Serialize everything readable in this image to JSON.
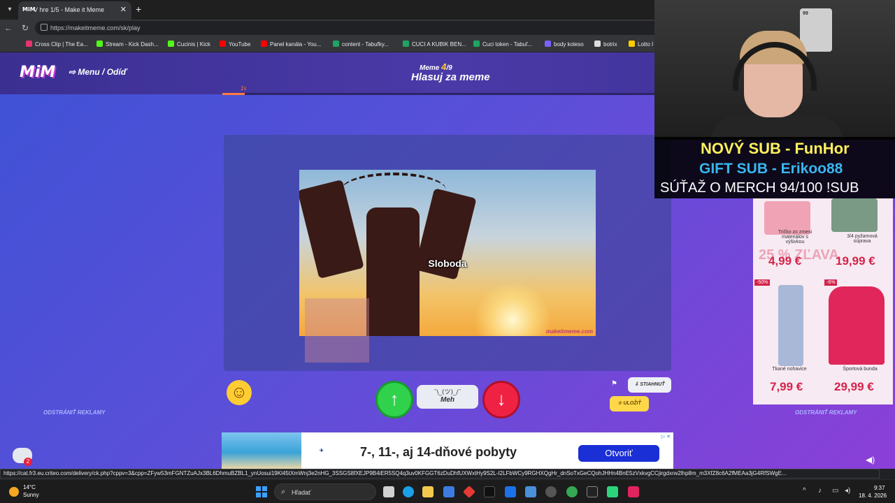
{
  "browser": {
    "tab_title": "V hre 1/5 - Make it Meme",
    "tab_favicon": "MiM",
    "url": "https://makeitmeme.com/sk/play",
    "bookmarks": [
      {
        "label": "Cross Clip | The Ea...",
        "color": "#e8336b"
      },
      {
        "label": "Stream - Kick Dash...",
        "color": "#53fc18"
      },
      {
        "label": "Cucinis | Kick",
        "color": "#53fc18"
      },
      {
        "label": "YouTube",
        "color": "#ff0000"
      },
      {
        "label": "Panel kanála - You...",
        "color": "#ff0000"
      },
      {
        "label": "content - Tabuľky...",
        "color": "#1fa463"
      },
      {
        "label": "CUCI A KUBIK BEN...",
        "color": "#1fa463"
      },
      {
        "label": "Cuci token - Tabuľ...",
        "color": "#1fa463"
      },
      {
        "label": "body koleso",
        "color": "#7b61ff"
      },
      {
        "label": "botrix",
        "color": "#dddddd"
      },
      {
        "label": "Lotto I",
        "color": "#ffcc00"
      }
    ]
  },
  "header": {
    "logo": "MiM",
    "menu_label": "Menu / Odíď",
    "round_prefix": "Meme",
    "round_current": "4",
    "round_total": "/9",
    "title": "Hlasuj za meme",
    "timer_label": "1s",
    "timer_fraction": 0.05
  },
  "meme": {
    "caption": "Sloboda",
    "watermark": "makeitmeme.com"
  },
  "vote": {
    "up_icon": "arrow-up-icon",
    "meh_face": "¯\\_(ツ)_/¯",
    "meh_label": "Meh",
    "down_icon": "arrow-down-icon",
    "download_label": "STIAHNUŤ",
    "save_label": "ULOŽIŤ",
    "remove_ads_left": "ODSTRÁNIŤ REKLAMY",
    "remove_ads_right": "ODSTRÁNIŤ REKLAMY"
  },
  "ad_banner": {
    "text": "7-, 11-, aj 14-dňové pobyty",
    "cta": "Otvoriť"
  },
  "side_ad": {
    "headline": "25 % ZĽAVA",
    "items": [
      {
        "name": "Tričko zo zmesi materiálov s výšivkou",
        "price": "4,99 €",
        "discount": ""
      },
      {
        "name": "3/4 pyžamová súprava",
        "price": "19,99 €",
        "discount": ""
      },
      {
        "name": "Tkané nohavice",
        "price": "7,99 €",
        "discount": "-50%"
      },
      {
        "name": "Športová bunda",
        "price": "29,99 €",
        "discount": "-6%"
      }
    ]
  },
  "chat": {
    "badge": "2"
  },
  "status_url": "https://cat.fr3.eu.criteo.com/delivery/ck.php?cppv=3&cpp=ZFyw53mFGNTZuAJx3BL6DhmuBZBL1_ynUosui19Kl45tXmWnj3e2nHG_3SSGS8fXEJP9B4iER5SQ4q3uv0KFGGT6zDuDhfUXWxtHy9S2L-I2LFbWCy9RGHXQgHr_dnSoTxGeCQohJHHn4BnE5zVxkvgCCjirgdxrw2lhp8m_m3XfZ8c6A2fMEAa3jG4RfSWgE...",
  "stream_overlay": {
    "card_number": "99",
    "line1": "NOVÝ SUB - FunHor",
    "line2": "GIFT SUB - Erikoo88",
    "line3": "SÚŤAŽ O MERCH  94/100 !SUB"
  },
  "taskbar": {
    "temperature": "14°C",
    "condition": "Sunny",
    "search_placeholder": "Hľadať",
    "time": "9:37",
    "date": "18. 4. 2026"
  }
}
